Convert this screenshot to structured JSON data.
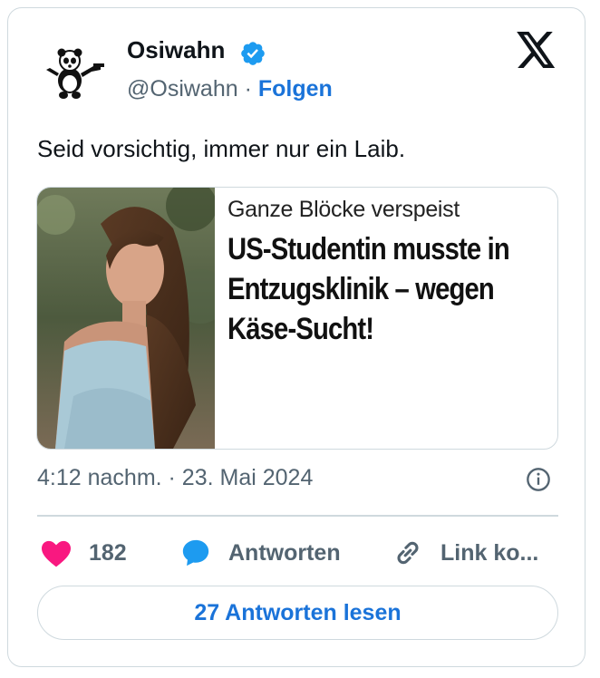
{
  "author": {
    "name": "Osiwahn",
    "handle": "@Osiwahn",
    "separator": "·",
    "follow_label": "Folgen"
  },
  "icons": {
    "verified": "verified-badge-icon",
    "platform": "x-logo-icon",
    "info": "info-icon",
    "like": "heart-icon",
    "reply": "speech-bubble-icon",
    "link": "link-icon"
  },
  "tweet": {
    "text": "Seid vorsichtig, immer nur ein Laib."
  },
  "media": {
    "kicker": "Ganze Blöcke verspeist",
    "headline": "US-Studentin musste in Entzugsklinik – wegen Käse-Sucht!"
  },
  "meta": {
    "timestamp": "4:12 nachm. · 23. Mai 2024"
  },
  "actions": {
    "likes": "182",
    "reply_label": "Antworten",
    "link_label": "Link ko..."
  },
  "read_replies_label": "27 Antworten lesen",
  "colors": {
    "accent": "#1a73d9",
    "like": "#f91880",
    "reply_icon": "#1d9bf0",
    "border": "#cfd9de",
    "muted": "#536471"
  }
}
